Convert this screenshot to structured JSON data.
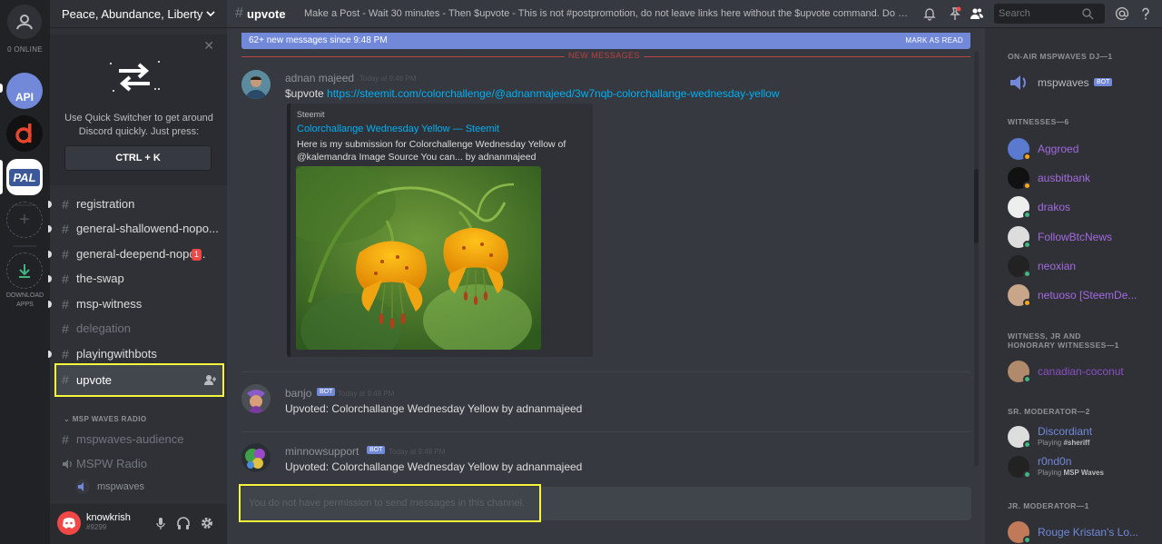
{
  "guilds": {
    "online_label": "0 ONLINE",
    "api_label": "API",
    "pal_label": "PAL",
    "download_label": "DOWNLOAD APPS"
  },
  "server": {
    "name": "Peace, Abundance, Liberty"
  },
  "quick_switcher": {
    "text": "Use Quick Switcher to get around Discord quickly. Just press:",
    "shortcut": "CTRL + K"
  },
  "channels": [
    {
      "name": "registration",
      "state": "normal"
    },
    {
      "name": "general-shallowend-nopo...",
      "state": "normal"
    },
    {
      "name": "general-deepend-nopo...",
      "state": "normal",
      "badge": "1"
    },
    {
      "name": "the-swap",
      "state": "normal"
    },
    {
      "name": "msp-witness",
      "state": "normal"
    },
    {
      "name": "delegation",
      "state": "muted"
    },
    {
      "name": "playingwithbots",
      "state": "normal"
    },
    {
      "name": "upvote",
      "state": "active"
    }
  ],
  "radio_category": "MSP WAVES RADIO",
  "radio_channels": [
    {
      "name": "mspwaves-audience",
      "type": "text"
    },
    {
      "name": "MSPW Radio",
      "type": "voice"
    }
  ],
  "voice_user": "mspwaves",
  "user": {
    "name": "knowkrish",
    "tag": "#9299"
  },
  "topbar": {
    "channel": "upvote",
    "topic": "Make a Post - Wait 30 minutes - Then $upvote - This is not #postpromotion, do not leave links here without the $upvote command. Do not...",
    "search_placeholder": "Search"
  },
  "new_messages": {
    "text": "62+ new messages since 9:48 PM",
    "action": "MARK AS READ"
  },
  "divider_label": "NEW MESSAGES",
  "messages": [
    {
      "author": "adnan majeed",
      "time": "Today at 9:48 PM",
      "bot": false,
      "prefix": "$upvote ",
      "link": "https://steemit.com/colorchallenge/@adnanmajeed/3w7nqb-colorchallange-wednesday-yellow",
      "embed": {
        "provider": "Steemit",
        "title": "Colorchallange Wednesday Yellow — Steemit",
        "description": "Here is my submission for Colorchallenge Wednesday Yellow of @kalemandra Image Source You can... by adnanmajeed"
      }
    },
    {
      "author": "banjo",
      "time": "Today at 9:49 PM",
      "bot": true,
      "bot_label": "BOT",
      "text": "Upvoted: Colorchallange Wednesday Yellow by adnanmajeed"
    },
    {
      "author": "minnowsupport",
      "time": "Today at 9:49 PM",
      "bot": true,
      "bot_label": "BOT",
      "text": "Upvoted: Colorchallange Wednesday Yellow by adnanmajeed"
    }
  ],
  "input_placeholder": "You do not have permission to send messages in this channel.",
  "members": {
    "groups": [
      {
        "title": "ON-AIR MSPWAVES DJ—1",
        "items": [
          {
            "name": "mspwaves",
            "color": "#b9bbbe",
            "bot": true
          }
        ]
      },
      {
        "title": "WITNESSES—6",
        "items": [
          {
            "name": "Aggroed",
            "color": "#a36ae0",
            "status": "#faa61a"
          },
          {
            "name": "ausbitbank",
            "color": "#a36ae0",
            "status": "#faa61a"
          },
          {
            "name": "drakos",
            "color": "#a36ae0",
            "status": "#43b581"
          },
          {
            "name": "FollowBtcNews",
            "color": "#a36ae0",
            "status": "#43b581"
          },
          {
            "name": "neoxian",
            "color": "#a36ae0",
            "status": "#43b581"
          },
          {
            "name": "netuoso [SteemDe...",
            "color": "#a36ae0",
            "status": "#faa61a"
          }
        ]
      },
      {
        "title": "WITNESS, JR AND HONORARY WITNESSES—1",
        "items": [
          {
            "name": "canadian-coconut",
            "color": "#8a4fc2",
            "status": "#43b581"
          }
        ]
      },
      {
        "title": "SR. MODERATOR—2",
        "items": [
          {
            "name": "Discordiant",
            "color": "#7289da",
            "status": "#43b581",
            "activity": "Playing",
            "game": "#sheriff"
          },
          {
            "name": "r0nd0n",
            "color": "#7289da",
            "status": "#43b581",
            "activity": "Playing",
            "game": "MSP Waves"
          }
        ]
      },
      {
        "title": "JR. MODERATOR—1",
        "items": [
          {
            "name": "Rouge Kristan's Lo...",
            "color": "#7289da",
            "status": "#43b581"
          }
        ]
      }
    ]
  }
}
